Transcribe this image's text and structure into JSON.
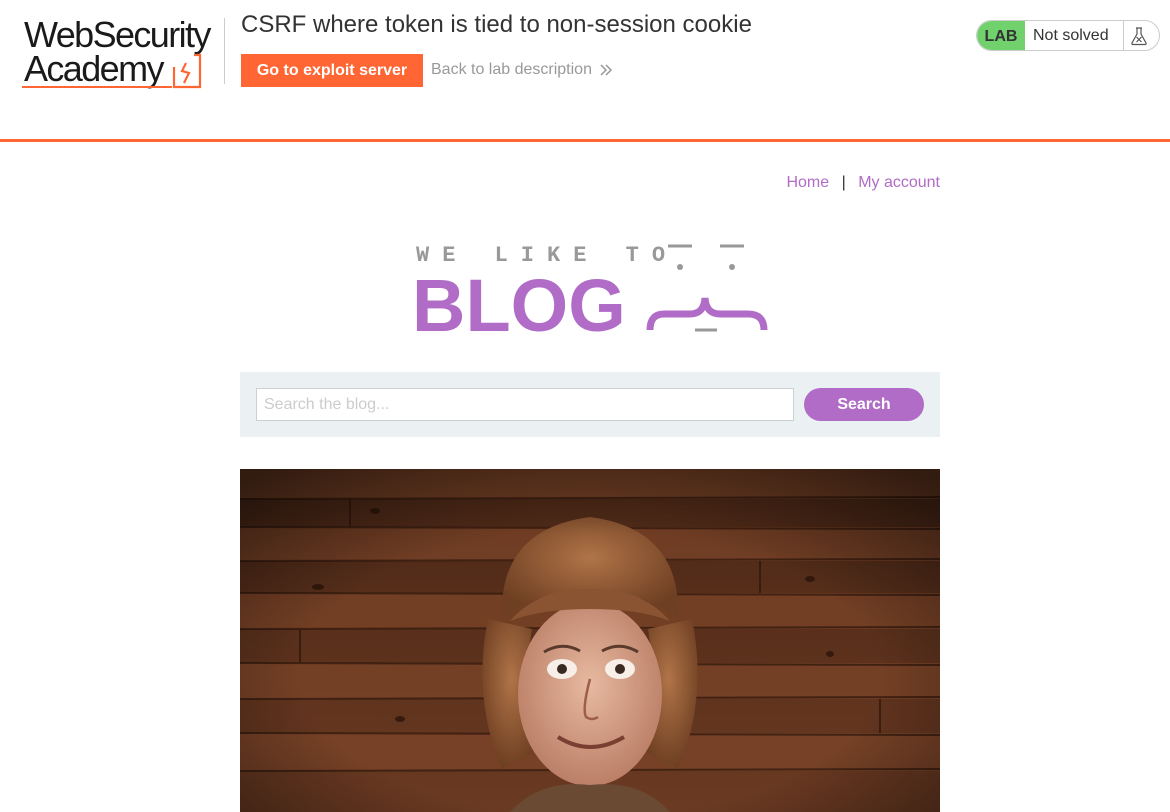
{
  "lab_header": {
    "logo": {
      "line1": "WebSecurity",
      "line2": "Academy"
    },
    "title": "CSRF where token is tied to non-session cookie",
    "exploit_button": "Go to exploit server",
    "back_link": "Back to lab description",
    "status": {
      "badge": "LAB",
      "text": "Not solved"
    }
  },
  "nav": {
    "home": "Home",
    "separator": "|",
    "my_account": "My account"
  },
  "blog_logo": {
    "tagline": "WE LIKE TO",
    "word": "BLOG"
  },
  "search": {
    "placeholder": "Search the blog...",
    "button": "Search"
  },
  "colors": {
    "accent_orange": "#ff6633",
    "lab_green": "#70d16d",
    "blog_purple": "#b06cc6",
    "search_bg": "#ebf0f2"
  },
  "icons": [
    "academy-mark-icon",
    "chevron-double-right-icon",
    "flask-icon"
  ]
}
